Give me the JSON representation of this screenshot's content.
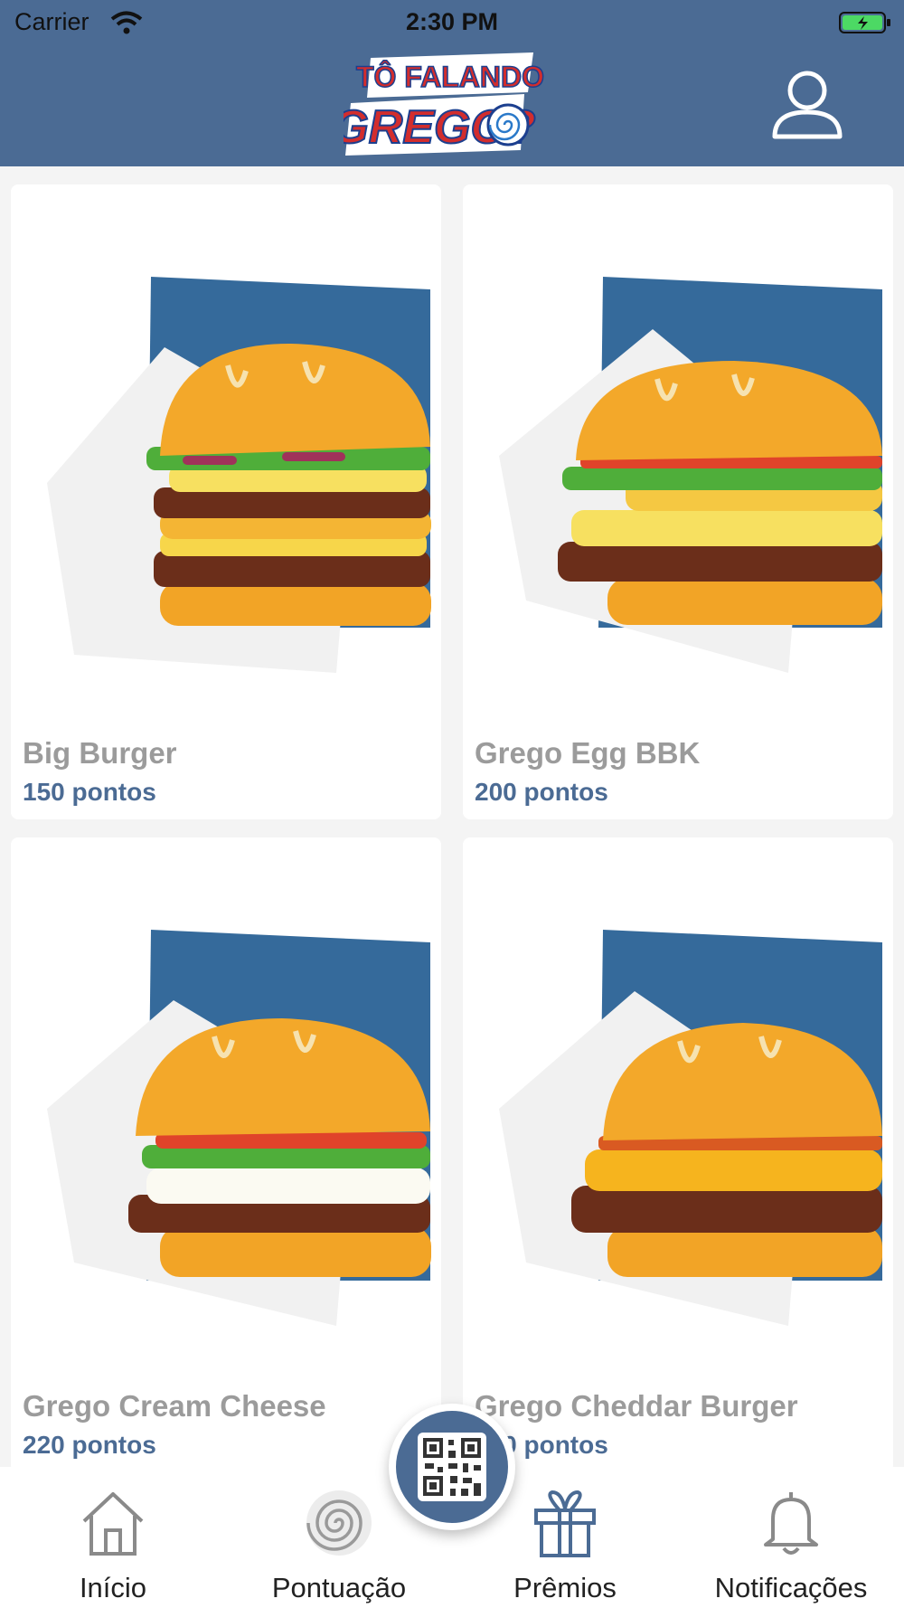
{
  "status_bar": {
    "carrier": "Carrier",
    "time": "2:30 PM"
  },
  "header": {
    "logo_lines": [
      "TÔ FALANDO",
      "GREGO?"
    ],
    "profile_icon": "user-icon",
    "background_color": "#4b6b94"
  },
  "products": [
    {
      "name": "Big Burger",
      "points": "150 pontos"
    },
    {
      "name": "Grego Egg BBK",
      "points": "200 pontos"
    },
    {
      "name": "Grego Cream Cheese",
      "points": "220 pontos"
    },
    {
      "name": "Grego Cheddar Burger",
      "points": "200 pontos"
    }
  ],
  "tabbar": {
    "tabs": [
      {
        "label": "Início",
        "icon": "home-icon"
      },
      {
        "label": "Pontuação",
        "icon": "spiral-icon"
      },
      {
        "label": "Prêmios",
        "icon": "gift-icon",
        "active": true
      },
      {
        "label": "Notificações",
        "icon": "bell-icon"
      }
    ],
    "center_button_icon": "qr-code-icon"
  },
  "colors": {
    "accent": "#4b6b94",
    "product_name": "#9b9b9b",
    "background": "#f4f4f4"
  }
}
